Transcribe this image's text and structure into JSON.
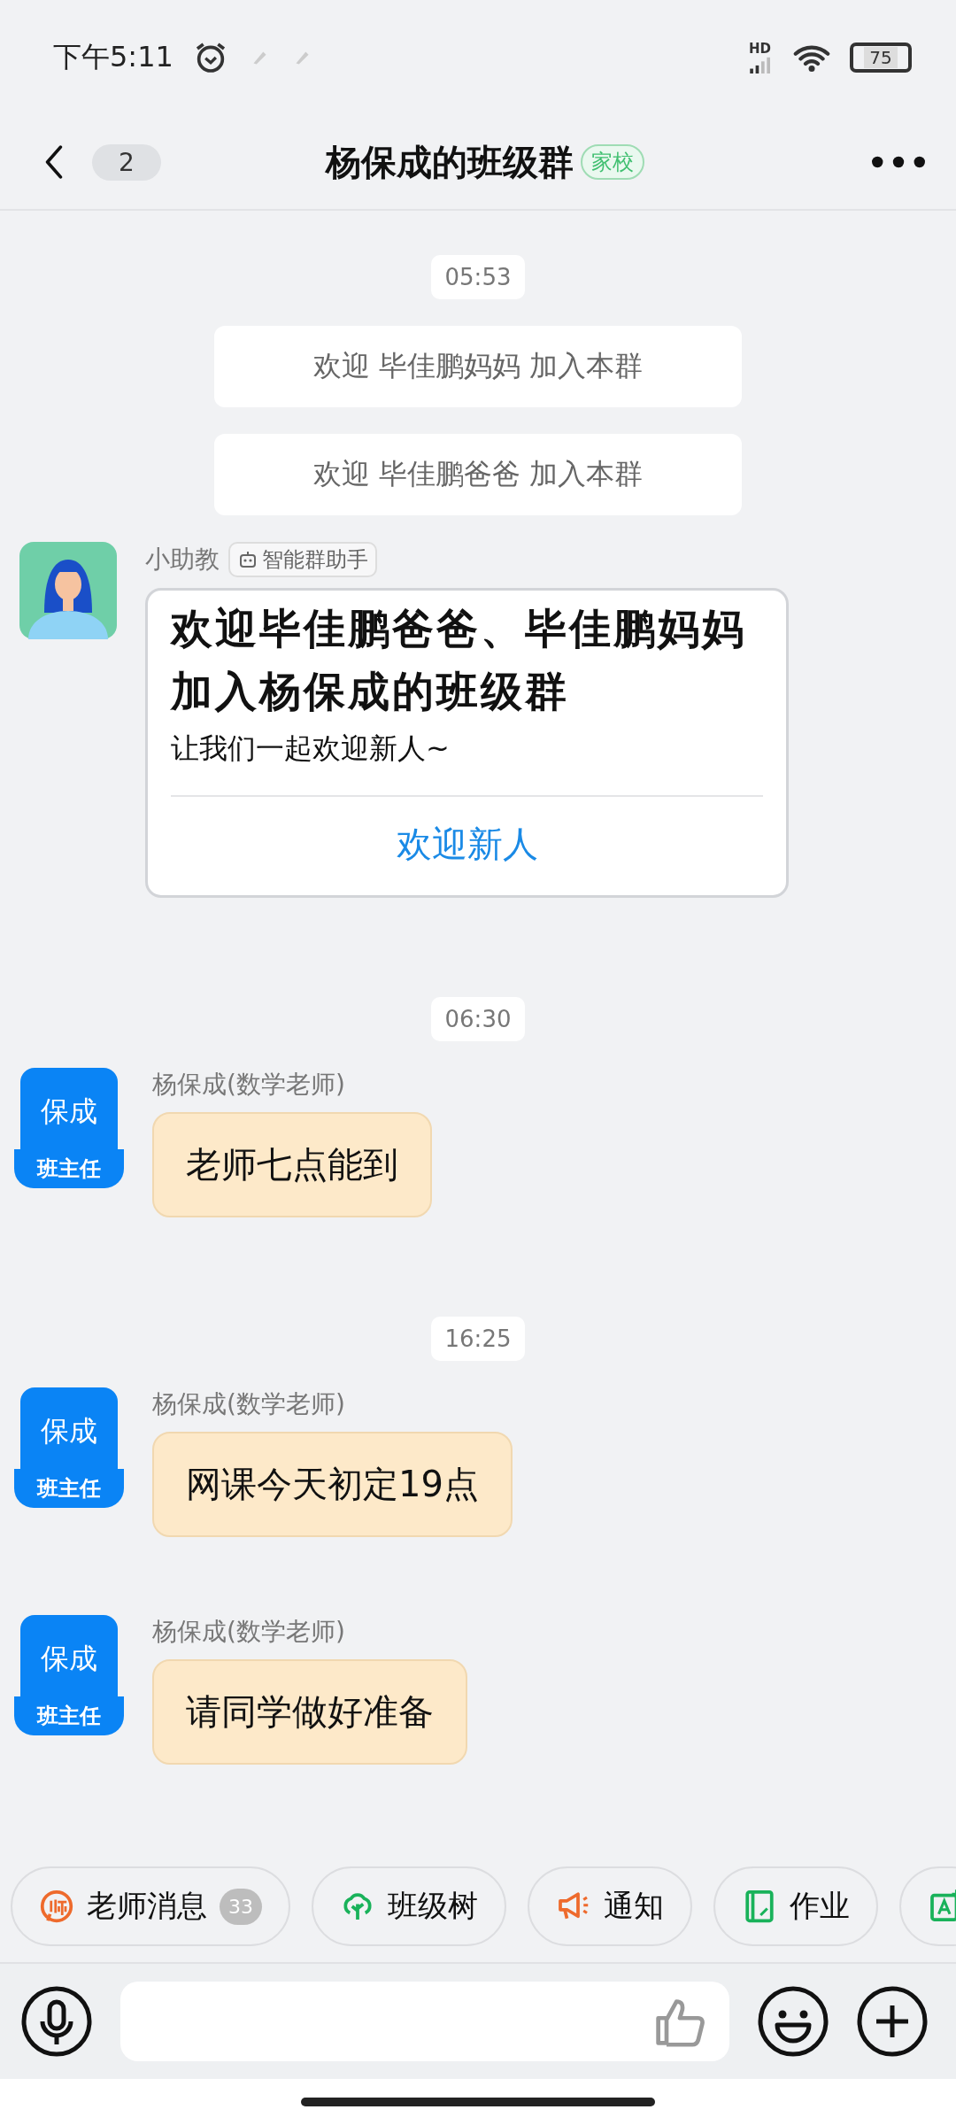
{
  "status_bar": {
    "time": "下午5:11",
    "network_label": "HD",
    "battery": "75"
  },
  "header": {
    "unread": "2",
    "title": "杨保成的班级群",
    "tag": "家校"
  },
  "messages": [
    {
      "kind": "time",
      "text": "05:53"
    },
    {
      "kind": "notice",
      "text": "欢迎 毕佳鹏妈妈 加入本群"
    },
    {
      "kind": "notice",
      "text": "欢迎 毕佳鹏爸爸 加入本群"
    },
    {
      "kind": "assistant_card",
      "sender": "小助教",
      "sender_tag": "智能群助手",
      "title": "欢迎毕佳鹏爸爸、毕佳鹏妈妈加入杨保成的班级群",
      "subtitle": "让我们一起欢迎新人~",
      "action": "欢迎新人"
    },
    {
      "kind": "time",
      "text": "06:30"
    },
    {
      "kind": "message",
      "avatar_text": "保成",
      "avatar_role": "班主任",
      "sender": "杨保成(数学老师)",
      "text": "老师七点能到"
    },
    {
      "kind": "time",
      "text": "16:25"
    },
    {
      "kind": "message",
      "avatar_text": "保成",
      "avatar_role": "班主任",
      "sender": "杨保成(数学老师)",
      "text": "网课今天初定19点"
    },
    {
      "kind": "message",
      "avatar_text": "保成",
      "avatar_role": "班主任",
      "sender": "杨保成(数学老师)",
      "text": "请同学做好准备"
    }
  ],
  "quick_actions": [
    {
      "kind": "teacher",
      "label": "老师消息",
      "badge": "33"
    },
    {
      "kind": "tree",
      "label": "班级树"
    },
    {
      "kind": "megaphone",
      "label": "通知"
    },
    {
      "kind": "notebook",
      "label": "作业"
    },
    {
      "kind": "grade"
    }
  ]
}
